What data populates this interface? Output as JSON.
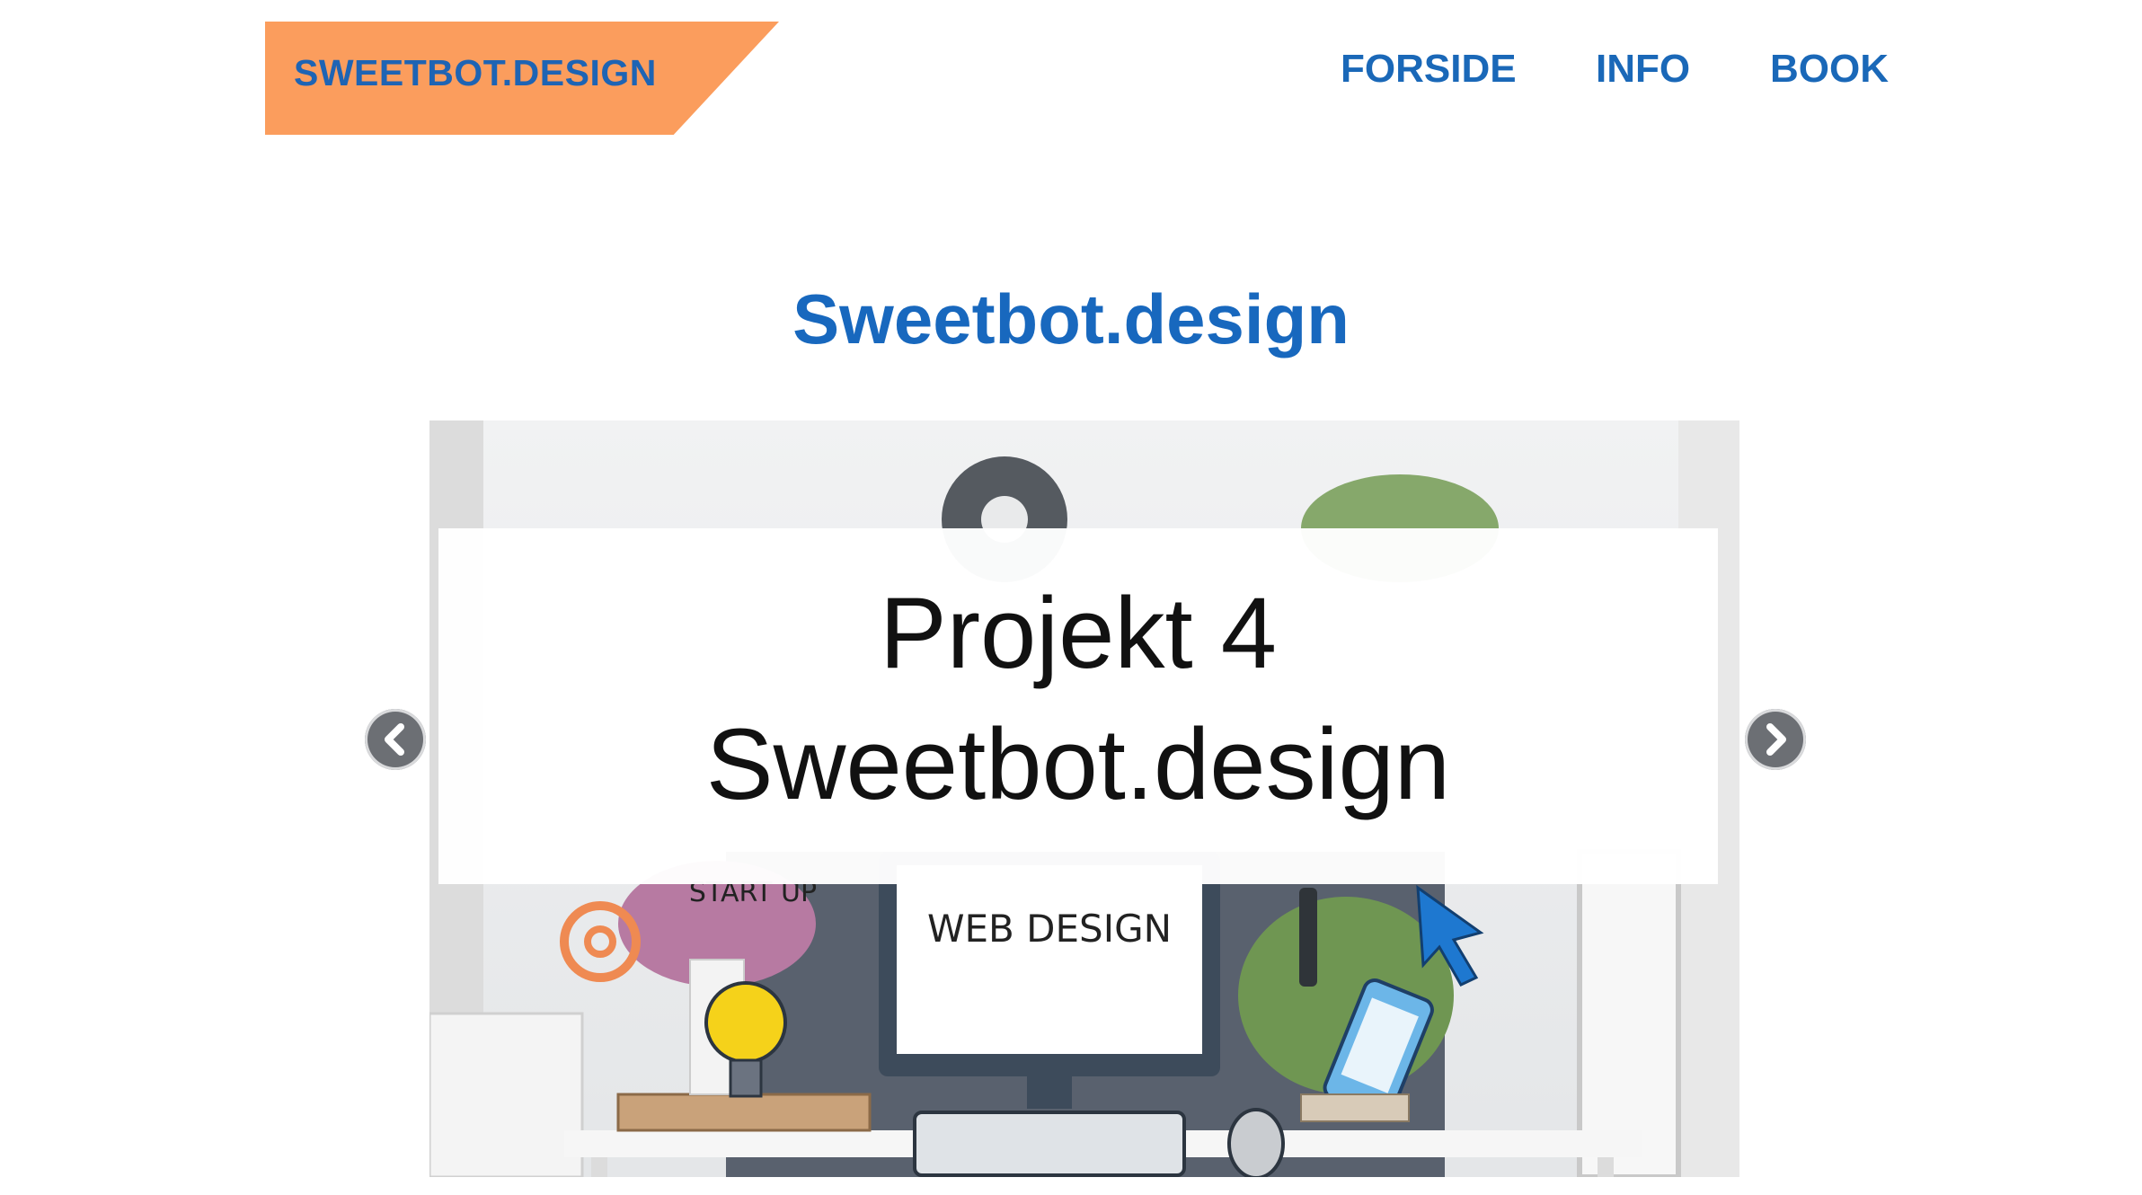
{
  "header": {
    "logo_text": "SWEETBOT.DESIGN",
    "logo_bg": "#fb9d5d",
    "nav": [
      {
        "label": "FORSIDE"
      },
      {
        "label": "INFO"
      },
      {
        "label": "BOOK"
      }
    ]
  },
  "main": {
    "title": "Sweetbot.design",
    "carousel": {
      "slide_line1": "Projekt 4",
      "slide_line2": "Sweetbot.design",
      "illustration_text_1": "START UP",
      "illustration_text_2": "WEB DESIGN",
      "prev_icon": "chevron-left-icon",
      "next_icon": "chevron-right-icon"
    }
  },
  "colors": {
    "accent_blue": "#1a68b8",
    "logo_orange": "#fb9d5d",
    "arrow_grey": "#6c6f74"
  }
}
